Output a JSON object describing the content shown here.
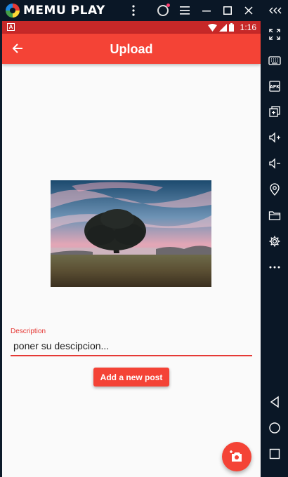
{
  "emulator": {
    "brand": "MEMU PLAY",
    "accent": "#0a1726",
    "title_controls": [
      "kebab-menu-icon",
      "account-icon",
      "hamburger-menu-icon",
      "minimize-icon",
      "maximize-icon",
      "close-icon",
      "collapse-sidebar-icon"
    ],
    "sidebar_tools": [
      "fullscreen-icon",
      "keyboard-icon",
      "apk-icon",
      "multi-instance-icon",
      "volume-up-icon",
      "volume-down-icon",
      "location-icon",
      "folder-icon",
      "settings-icon",
      "more-icon",
      "android-back-icon",
      "android-home-icon",
      "android-recents-icon"
    ]
  },
  "status_bar": {
    "notification_badge": "A",
    "time": "1:16",
    "color": "#c62828"
  },
  "app_bar": {
    "title": "Upload",
    "color": "#f44336"
  },
  "form": {
    "image_alt": "landscape-tree-photo",
    "description_label": "Description",
    "description_value": "poner su descipcion...",
    "submit_label": "Add a new post"
  },
  "fab": {
    "icon": "add-photo-icon"
  }
}
